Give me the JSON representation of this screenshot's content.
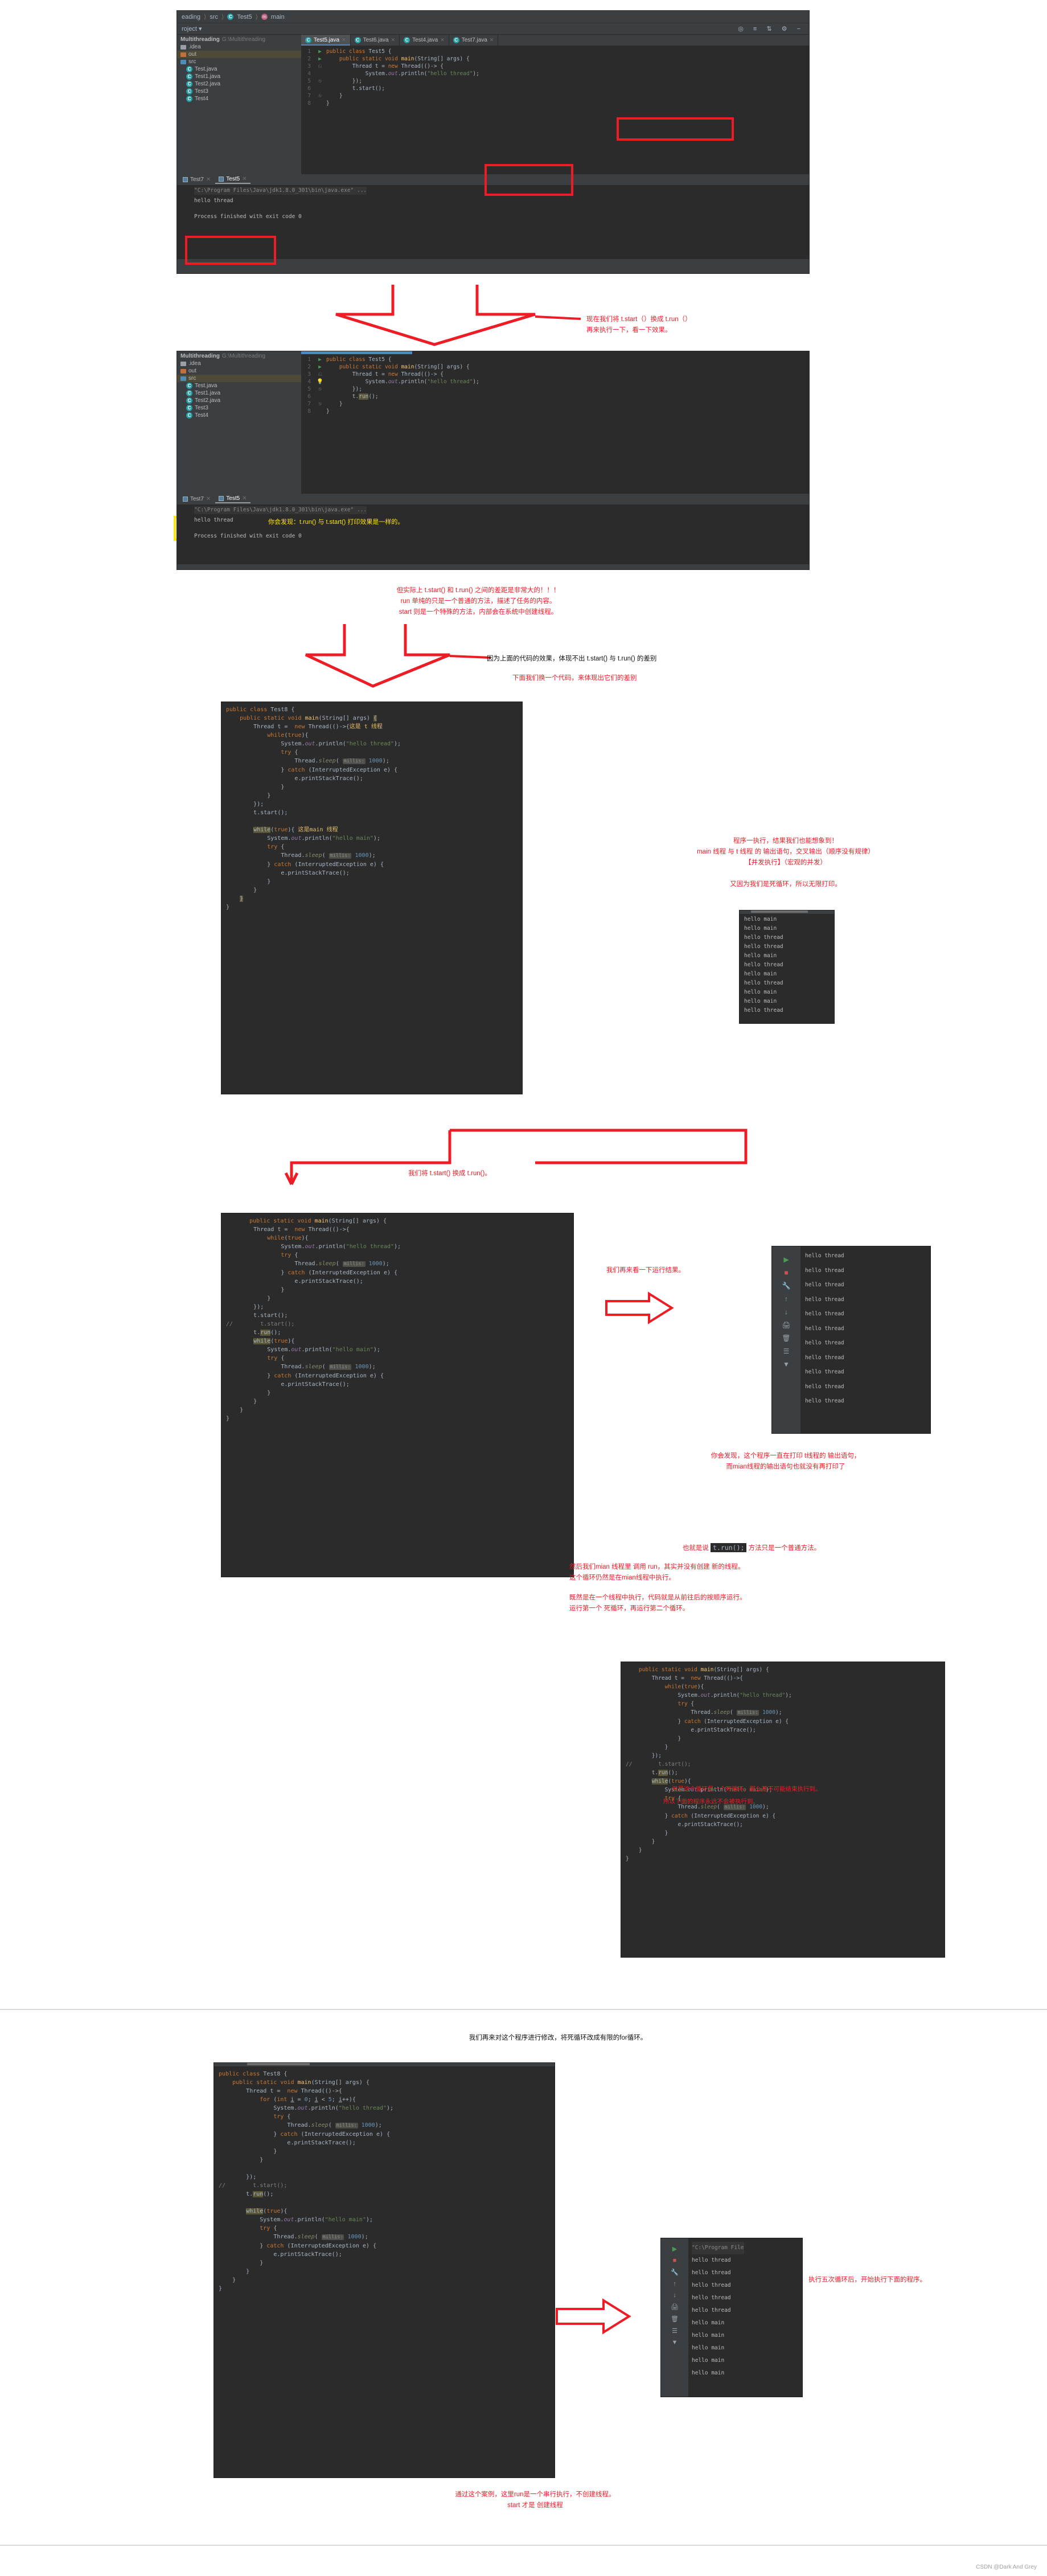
{
  "meta": {
    "credit": "CSDN @Dark And Grey"
  },
  "shot1": {
    "breadcrumb": [
      "eading",
      "src",
      "Test5",
      "main"
    ],
    "toolbar_label": "roject",
    "tree": [
      {
        "label": "Multithreading",
        "path": "G:\\Multithreading",
        "type": "project"
      },
      {
        "label": ".idea",
        "type": "folder-grey"
      },
      {
        "label": "out",
        "type": "folder-orange",
        "selected": true
      },
      {
        "label": "src",
        "type": "folder-blue"
      },
      {
        "label": "Test.java",
        "type": "class"
      },
      {
        "label": "Test1.java",
        "type": "class"
      },
      {
        "label": "Test2.java",
        "type": "class"
      },
      {
        "label": "Test3",
        "type": "class"
      },
      {
        "label": "Test4",
        "type": "class"
      }
    ],
    "tabs": [
      {
        "label": "Test5.java",
        "active": true
      },
      {
        "label": "Test6.java",
        "active": false
      },
      {
        "label": "Test4.java",
        "active": false
      },
      {
        "label": "Test7.java",
        "active": false
      }
    ],
    "code_lines": [
      {
        "no": "1",
        "mark": "run",
        "text": "public class Test5 {"
      },
      {
        "no": "2",
        "mark": "run",
        "text": "    public static void main(String[] args) {"
      },
      {
        "no": "3",
        "mark": "fold",
        "text": "        Thread t = new Thread(()-> {"
      },
      {
        "no": "4",
        "mark": "",
        "text": "            System.out.println(\"hello thread\");"
      },
      {
        "no": "5",
        "mark": "fold",
        "text": "        });"
      },
      {
        "no": "6",
        "mark": "",
        "text": "        t.start();"
      },
      {
        "no": "7",
        "mark": "fold",
        "text": "    }"
      },
      {
        "no": "8",
        "mark": "",
        "text": "}"
      }
    ],
    "run_tabs": [
      {
        "label": "Test7",
        "active": false
      },
      {
        "label": "Test5",
        "active": true
      }
    ],
    "console": [
      "\"C:\\Program Files\\Java\\jdk1.8.0_301\\bin\\java.exe\" ...",
      "hello thread",
      "",
      "Process finished with exit code 0"
    ]
  },
  "anno1": "现在我们将 t.start（）换成 t.run（）\n再来执行一下，看一下效果。",
  "shot2": {
    "project_title": "Multithreading",
    "project_path": "G:\\Multithreading",
    "tree": [
      {
        "label": ".idea",
        "type": "folder-grey"
      },
      {
        "label": "out",
        "type": "folder-orange"
      },
      {
        "label": "src",
        "type": "folder-blue",
        "selected": true
      },
      {
        "label": "Test.java",
        "type": "class"
      },
      {
        "label": "Test1.java",
        "type": "class"
      },
      {
        "label": "Test2.java",
        "type": "class"
      },
      {
        "label": "Test3",
        "type": "class"
      },
      {
        "label": "Test4",
        "type": "class"
      }
    ],
    "code_lines": [
      {
        "no": "1",
        "mark": "run",
        "text": "public class Test5 {"
      },
      {
        "no": "2",
        "mark": "run",
        "text": "    public static void main(String[] args) {"
      },
      {
        "no": "3",
        "mark": "fold",
        "text": "        Thread t = new Thread(()-> {"
      },
      {
        "no": "4",
        "mark": "bulb",
        "text": "            System.out.println(\"hello thread\");"
      },
      {
        "no": "5",
        "mark": "fold",
        "text": "        });"
      },
      {
        "no": "6",
        "mark": "",
        "text": "        t.run();"
      },
      {
        "no": "7",
        "mark": "fold",
        "text": "    }"
      },
      {
        "no": "8",
        "mark": "",
        "text": "}"
      }
    ],
    "run_tabs": [
      {
        "label": "Test7",
        "active": false
      },
      {
        "label": "Test5",
        "active": true
      }
    ],
    "console": [
      "\"C:\\Program Files\\Java\\jdk1.8.0_301\\bin\\java.exe\" ...",
      "hello thread",
      "",
      "Process finished with exit code 0"
    ],
    "console_note": "你会发现：t.run() 与 t.start() 打印效果是一样的。"
  },
  "anno2": "但实际上 t.start() 和 t.run() 之间的差距是非常大的！！！\nrun 单纯的只是一个普通的方法，描述了任务的内容。\nstart 则是一个特殊的方法，内部会在系统中创建线程。",
  "anno3_dark": "因为上面的代码的效果，体现不出 t.start() 与 t.run() 的差别",
  "anno3_red": "下面我们换一个代码，来体现出它们的差别",
  "shot3": {
    "code_lines": [
      {
        "text": "public class Test8 {"
      },
      {
        "text": "    public static void main(String[] args) {"
      },
      {
        "text": "        Thread t =  new Thread(()->{",
        "note": "这是 t 线程"
      },
      {
        "text": "            while(true){"
      },
      {
        "text": "                System.out.println(\"hello thread\");"
      },
      {
        "text": "                try {"
      },
      {
        "text": "                    Thread.sleep( millis: 1000);"
      },
      {
        "text": "                } catch (InterruptedException e) {"
      },
      {
        "text": "                    e.printStackTrace();"
      },
      {
        "text": "                }"
      },
      {
        "text": "            }"
      },
      {
        "text": "        });"
      },
      {
        "text": "        t.start();"
      },
      {
        "text": ""
      },
      {
        "text": "        while(true){",
        "note": "这是main 线程"
      },
      {
        "text": "            System.out.println(\"hello main\");"
      },
      {
        "text": "            try {"
      },
      {
        "text": "                Thread.sleep( millis: 1000);"
      },
      {
        "text": "            } catch (InterruptedException e) {"
      },
      {
        "text": "                e.printStackTrace();"
      },
      {
        "text": "            }"
      },
      {
        "text": "        }"
      },
      {
        "text": "    }"
      },
      {
        "text": "}"
      }
    ],
    "anno": "程序一执行，结果我们也能想象到！\nmain 线程 与 t 线程 的 输出语句，交叉输出（顺序没有规律）\n【并发执行】（宏观的并发）\n\n又因为我们是死循环，所以无限打印。",
    "output": [
      "hello main",
      "hello main",
      "hello thread",
      "hello thread",
      "hello main",
      "hello thread",
      "hello main",
      "hello thread",
      "hello main",
      "hello main",
      "hello thread"
    ]
  },
  "anno4": "我们将  t.start()  换成 t.run()。",
  "shot4": {
    "code_lines": [
      {
        "text": "    public static void main(String[] args) {"
      },
      {
        "text": "        Thread t =  new Thread(()->{"
      },
      {
        "text": "            while(true){"
      },
      {
        "text": "                System.out.println(\"hello thread\");"
      },
      {
        "text": "                try {"
      },
      {
        "text": "                    Thread.sleep( millis: 1000);"
      },
      {
        "text": "                } catch (InterruptedException e) {"
      },
      {
        "text": "                    e.printStackTrace();"
      },
      {
        "text": "                }"
      },
      {
        "text": "            }"
      },
      {
        "text": "        });"
      },
      {
        "text": "        t.start();"
      },
      {
        "text": "//        t.start();"
      },
      {
        "text": "        t.run();"
      },
      {
        "text": "        while(true){"
      },
      {
        "text": "            System.out.println(\"hello main\");"
      },
      {
        "text": "            try {"
      },
      {
        "text": "                Thread.sleep( millis: 1000);"
      },
      {
        "text": "            } catch (InterruptedException e) {"
      },
      {
        "text": "                e.printStackTrace();"
      },
      {
        "text": "            }"
      },
      {
        "text": "        }"
      },
      {
        "text": "    }"
      },
      {
        "text": "}"
      }
    ],
    "anno_left": "我们再来看一下运行结果。",
    "output": [
      "hello thread",
      "hello thread",
      "hello thread",
      "hello thread",
      "hello thread",
      "hello thread",
      "hello thread",
      "hello thread",
      "hello thread",
      "hello thread",
      "hello thread"
    ],
    "anno_below": "你会发现，这个程序一直在打印 t线程的 输出语句，\n而mian线程的输出语句也就没有再打印了"
  },
  "anno5": {
    "line1_pre": "也就是说 ",
    "line1_code": "t.run();",
    "line1_post": " 方法只是一个普通方法。",
    "line2": "然后我们mian 线程里 调用 run，其实并没有创建 新的线程。\n这个循环仍然是在mian线程中执行。",
    "line3": "既然是在一个线程中执行，代码就是从前往后的按顺序运行。\n运行第一个 死循环，再运行第二个循环。"
  },
  "shot5": {
    "code_lines": [
      {
        "text": "    public static void main(String[] args) {"
      },
      {
        "text": "        Thread t =  new Thread(()->{"
      },
      {
        "text": "            while(true){"
      },
      {
        "text": "                System.out.println(\"hello thread\");"
      },
      {
        "text": "                try {"
      },
      {
        "text": "                    Thread.sleep( millis: 1000);"
      },
      {
        "text": "                } catch (InterruptedException e) {"
      },
      {
        "text": "                    e.printStackTrace();"
      },
      {
        "text": "                }"
      },
      {
        "text": "            }"
      },
      {
        "text": "        });"
      },
      {
        "text": "//        t.start();"
      },
      {
        "text": "        t.run();"
      },
      {
        "text": "        while(true){"
      },
      {
        "text": "            System.out.println(\"hello main\");"
      },
      {
        "text": "            try {"
      },
      {
        "text": "                Thread.sleep( millis: 1000);"
      },
      {
        "text": "            } catch (InterruptedException e) {"
      },
      {
        "text": "                e.printStackTrace();"
      },
      {
        "text": "            }"
      },
      {
        "text": "        }"
      },
      {
        "text": "    }"
      },
      {
        "text": "}"
      }
    ],
    "note_top": "但是这个循环是一个死循环，那么基不可能结束执行到。",
    "note_bottom": "所以下面的程序永远不会被执行到。"
  },
  "anno6": "我们再来对这个程序进行修改，将死循环改成有限的for循环。",
  "shot6": {
    "code_lines": [
      {
        "text": "public class Test8 {"
      },
      {
        "text": "    public static void main(String[] args) {"
      },
      {
        "text": "        Thread t =  new Thread(()->{"
      },
      {
        "text": "            for (int i = 0; i < 5; i++){"
      },
      {
        "text": "                System.out.println(\"hello thread\");"
      },
      {
        "text": "                try {"
      },
      {
        "text": "                    Thread.sleep( millis: 1000);"
      },
      {
        "text": "                } catch (InterruptedException e) {"
      },
      {
        "text": "                    e.printStackTrace();"
      },
      {
        "text": "                }"
      },
      {
        "text": "            }"
      },
      {
        "text": ""
      },
      {
        "text": "        });"
      },
      {
        "text": "//        t.start();"
      },
      {
        "text": "        t.run();"
      },
      {
        "text": ""
      },
      {
        "text": "        while(true){"
      },
      {
        "text": "            System.out.println(\"hello main\");"
      },
      {
        "text": "            try {"
      },
      {
        "text": "                Thread.sleep( millis: 1000);"
      },
      {
        "text": "            } catch (InterruptedException e) {"
      },
      {
        "text": "                e.printStackTrace();"
      },
      {
        "text": "            }"
      },
      {
        "text": "        }"
      },
      {
        "text": "    }"
      },
      {
        "text": "}"
      }
    ],
    "output_header": "\"C:\\Program File",
    "output": [
      "hello thread",
      "hello thread",
      "hello thread",
      "hello thread",
      "hello thread",
      "hello main",
      "hello main",
      "hello main",
      "hello main",
      "hello main"
    ],
    "anno_right": "执行五次循环后，开始执行下面的程序。"
  },
  "anno7": "通过这个案例，这里run是一个串行执行，不创建线程。\nstart 才是 创建线程"
}
